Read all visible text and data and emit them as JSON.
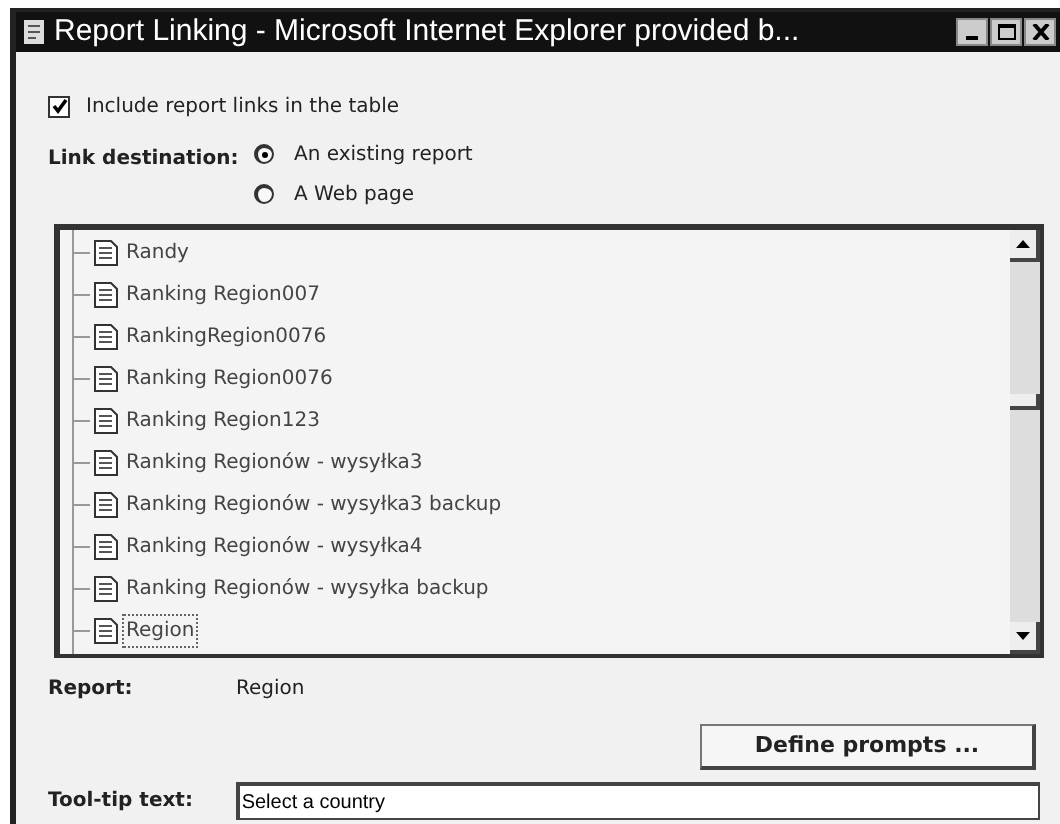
{
  "window": {
    "title": "Report Linking - Microsoft Internet Explorer provided b..."
  },
  "include_links": {
    "label": "Include report links in the table",
    "checked": true
  },
  "link_destination": {
    "label": "Link destination:",
    "options": [
      {
        "label": "An existing report",
        "selected": true
      },
      {
        "label": "A Web page",
        "selected": false
      }
    ]
  },
  "reports": [
    {
      "label": "Randy",
      "selected": false
    },
    {
      "label": "Ranking Region007",
      "selected": false
    },
    {
      "label": "RankingRegion0076",
      "selected": false
    },
    {
      "label": "Ranking Region0076",
      "selected": false
    },
    {
      "label": "Ranking Region123",
      "selected": false
    },
    {
      "label": "Ranking Regionów - wysyłka3",
      "selected": false
    },
    {
      "label": "Ranking Regionów - wysyłka3 backup",
      "selected": false
    },
    {
      "label": "Ranking Regionów - wysyłka4",
      "selected": false
    },
    {
      "label": "Ranking Regionów - wysyłka backup",
      "selected": false
    },
    {
      "label": "Region",
      "selected": true
    }
  ],
  "report": {
    "label": "Report:",
    "value": "Region"
  },
  "define_prompts": {
    "label": "Define prompts ..."
  },
  "tooltip": {
    "label": "Tool-tip text:",
    "value": "Select a country"
  }
}
